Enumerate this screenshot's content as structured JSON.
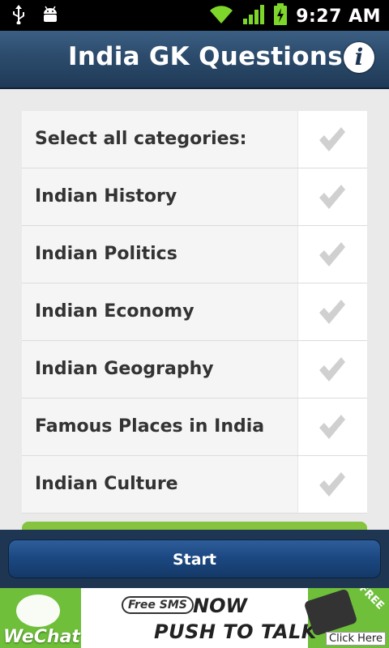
{
  "status_bar": {
    "icons": [
      "usb-icon",
      "android-debug-icon",
      "wifi-icon",
      "signal-icon",
      "battery-charging-icon"
    ],
    "time": "9:27 AM"
  },
  "header": {
    "title": "India GK Questions",
    "info_label": "i"
  },
  "categories": [
    {
      "label": "Select all categories:",
      "checked": true
    },
    {
      "label": "Indian History",
      "checked": true
    },
    {
      "label": "Indian Politics",
      "checked": true
    },
    {
      "label": "Indian Economy",
      "checked": true
    },
    {
      "label": "Indian Geography",
      "checked": true
    },
    {
      "label": "Famous Places in India",
      "checked": true
    },
    {
      "label": "Indian Culture",
      "checked": true
    }
  ],
  "start_button": {
    "label": "Start"
  },
  "ad": {
    "brand": "WeChat",
    "free_sms": "Free SMS",
    "headline_1": "NOW",
    "headline_2": "PUSH TO TALK",
    "cta": "Click Here",
    "corner": "FREE"
  },
  "colors": {
    "header": "#2c4b6c",
    "start_button": "#1b4780",
    "check": "#d0d0d0",
    "ad_green": "#6fbf3b"
  }
}
